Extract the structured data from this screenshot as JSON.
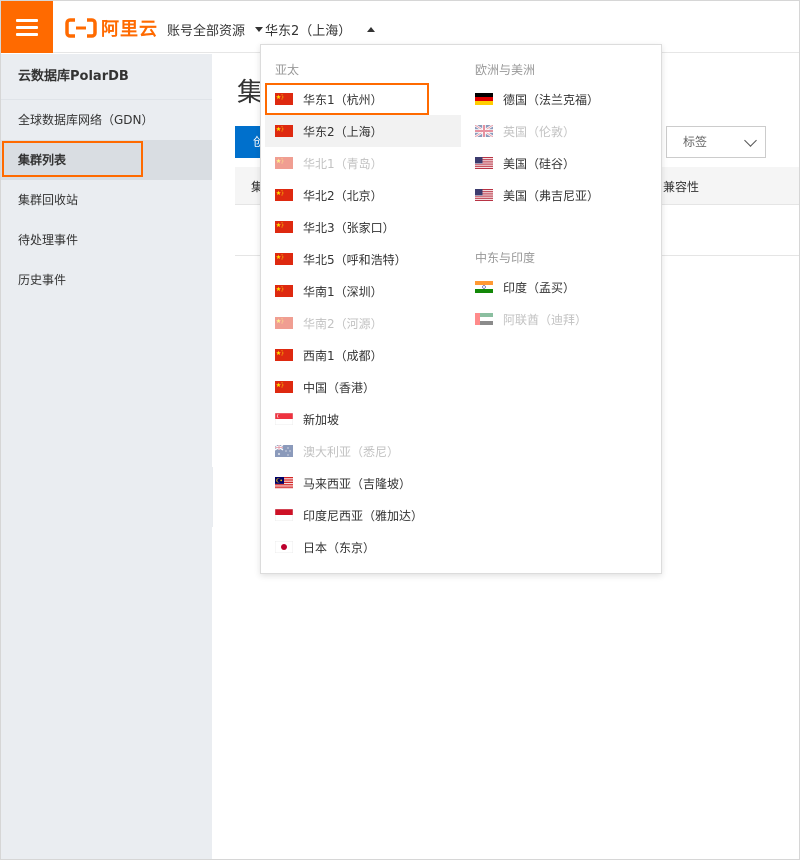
{
  "topbar": {
    "brand": "阿里云",
    "account_label": "账号全部资源",
    "region_label": "华东2（上海）"
  },
  "sidebar": {
    "title": "云数据库PolarDB",
    "items": [
      {
        "label": "全球数据库网络（GDN）"
      },
      {
        "label": "集群列表",
        "active": true
      },
      {
        "label": "集群回收站"
      },
      {
        "label": "待处理事件"
      },
      {
        "label": "历史事件"
      }
    ]
  },
  "main": {
    "title": "集",
    "create_button": "创",
    "tag_filter": "标签",
    "table": {
      "first_col": "集",
      "compat_col": "兼容性"
    }
  },
  "region_dropdown": {
    "groups_left": [
      {
        "title": "亚太",
        "options": [
          {
            "label": "华东1（杭州）",
            "flag": "cn",
            "state": "highlighted"
          },
          {
            "label": "华东2（上海）",
            "flag": "cn",
            "state": "current"
          },
          {
            "label": "华北1（青岛）",
            "flag": "cn",
            "state": "disabled"
          },
          {
            "label": "华北2（北京）",
            "flag": "cn",
            "state": "normal"
          },
          {
            "label": "华北3（张家口）",
            "flag": "cn",
            "state": "normal"
          },
          {
            "label": "华北5（呼和浩特）",
            "flag": "cn",
            "state": "normal"
          },
          {
            "label": "华南1（深圳）",
            "flag": "cn",
            "state": "normal"
          },
          {
            "label": "华南2（河源）",
            "flag": "cn",
            "state": "disabled"
          },
          {
            "label": "西南1（成都）",
            "flag": "cn",
            "state": "normal"
          },
          {
            "label": "中国（香港）",
            "flag": "cn",
            "state": "normal"
          },
          {
            "label": "新加坡",
            "flag": "sg",
            "state": "normal"
          },
          {
            "label": "澳大利亚（悉尼）",
            "flag": "au",
            "state": "disabled"
          },
          {
            "label": "马来西亚（吉隆坡）",
            "flag": "my",
            "state": "normal"
          },
          {
            "label": "印度尼西亚（雅加达）",
            "flag": "id",
            "state": "normal"
          },
          {
            "label": "日本（东京）",
            "flag": "jp",
            "state": "normal"
          }
        ]
      }
    ],
    "groups_right": [
      {
        "title": "欧洲与美洲",
        "options": [
          {
            "label": "德国（法兰克福）",
            "flag": "de",
            "state": "normal"
          },
          {
            "label": "英国（伦敦）",
            "flag": "gb",
            "state": "disabled"
          },
          {
            "label": "美国（硅谷）",
            "flag": "us",
            "state": "normal"
          },
          {
            "label": "美国（弗吉尼亚）",
            "flag": "us",
            "state": "normal"
          }
        ]
      },
      {
        "title": "中东与印度",
        "options": [
          {
            "label": "印度（孟买）",
            "flag": "in",
            "state": "normal"
          },
          {
            "label": "阿联酋（迪拜）",
            "flag": "ae",
            "state": "disabled"
          }
        ]
      }
    ]
  },
  "colors": {
    "brand_orange": "#ff6a00",
    "primary_blue": "#0070cc",
    "sidebar_bg": "#eaedf1",
    "disabled_text": "#c2c2c2"
  }
}
